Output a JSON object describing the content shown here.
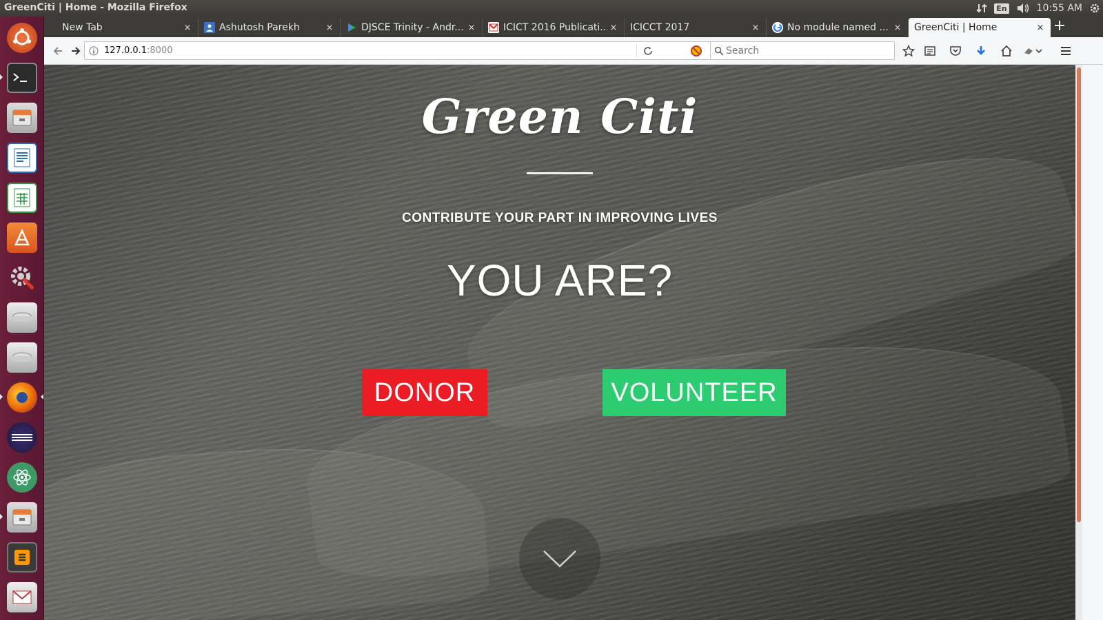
{
  "panel": {
    "window_title": "GreenCiti | Home - Mozilla Firefox",
    "language": "En",
    "time": "10:55 AM"
  },
  "launcher": {
    "items": [
      "dash-home",
      "terminal",
      "files",
      "writer",
      "calc",
      "software-center",
      "system-settings",
      "disk",
      "disk",
      "firefox",
      "eclipse",
      "atom",
      "files",
      "sublime-text",
      "gmail-notifier"
    ]
  },
  "tabs": [
    {
      "label": "New Tab"
    },
    {
      "label": "Ashutosh Parekh"
    },
    {
      "label": "DJSCE Trinity - Andr..."
    },
    {
      "label": "ICICT 2016 Publicati..."
    },
    {
      "label": "ICICCT 2017"
    },
    {
      "label": "No module named ..."
    },
    {
      "label": "GreenCiti | Home",
      "active": true
    }
  ],
  "tab_close_glyph": "×",
  "new_tab_glyph": "+",
  "navbar": {
    "url_host": "127.0.0.1",
    "url_port": ":8000",
    "search_placeholder": "Search"
  },
  "page": {
    "brand": "Green Citi",
    "tagline": "CONTRIBUTE YOUR PART IN IMPROVING LIVES",
    "question": "YOU ARE?",
    "donor_label": "DONOR",
    "volunteer_label": "VOLUNTEER"
  },
  "colors": {
    "donor": "#ec1c24",
    "volunteer": "#2ecc71",
    "launcher": "#5a1833",
    "panel": "#3c3b37"
  }
}
